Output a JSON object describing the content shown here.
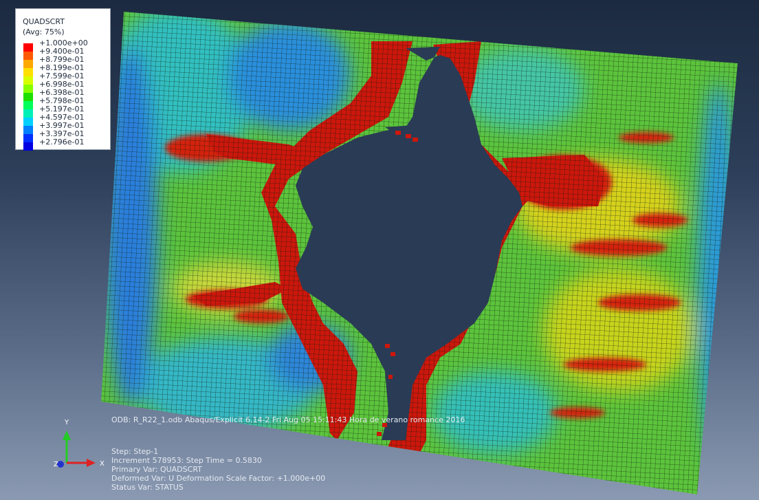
{
  "legend": {
    "title": "QUADSCRT",
    "subtitle": "(Avg: 75%)",
    "entries": [
      {
        "label": "+1.000e+00",
        "color": "#ff0000"
      },
      {
        "label": "+9.400e-01",
        "color": "#ff5a00"
      },
      {
        "label": "+8.799e-01",
        "color": "#ffa800"
      },
      {
        "label": "+8.199e-01",
        "color": "#ffe000"
      },
      {
        "label": "+7.599e-01",
        "color": "#d8ff00"
      },
      {
        "label": "+6.998e-01",
        "color": "#88ff00"
      },
      {
        "label": "+6.398e-01",
        "color": "#1ee000"
      },
      {
        "label": "+5.798e-01",
        "color": "#00ff5a"
      },
      {
        "label": "+5.197e-01",
        "color": "#00f0b8"
      },
      {
        "label": "+4.597e-01",
        "color": "#00d0ff"
      },
      {
        "label": "+3.997e-01",
        "color": "#0080ff"
      },
      {
        "label": "+3.397e-01",
        "color": "#0030ff"
      },
      {
        "label": "+2.796e-01",
        "color": "#0000e0"
      }
    ]
  },
  "odb_line": "ODB: R_R22_1.odb    Abaqus/Explicit 6.14-2    Fri Aug 05 15:11:43 Hora de verano romance 2016",
  "info_lines": [
    "Step: Step-1",
    "Increment    578953: Step Time =    0.5830",
    "Primary Var: QUADSCRT",
    "Deformed Var: U   Deformation Scale Factor: +1.000e+00",
    "Status Var: STATUS"
  ],
  "triad": {
    "x": "X",
    "y": "Y",
    "z": "Z"
  },
  "colors": {
    "crack": "#c8140c",
    "mesh_green": "#52c83a",
    "mesh_cyan": "#2fc4c8",
    "mesh_blue": "#1d6fd6"
  }
}
